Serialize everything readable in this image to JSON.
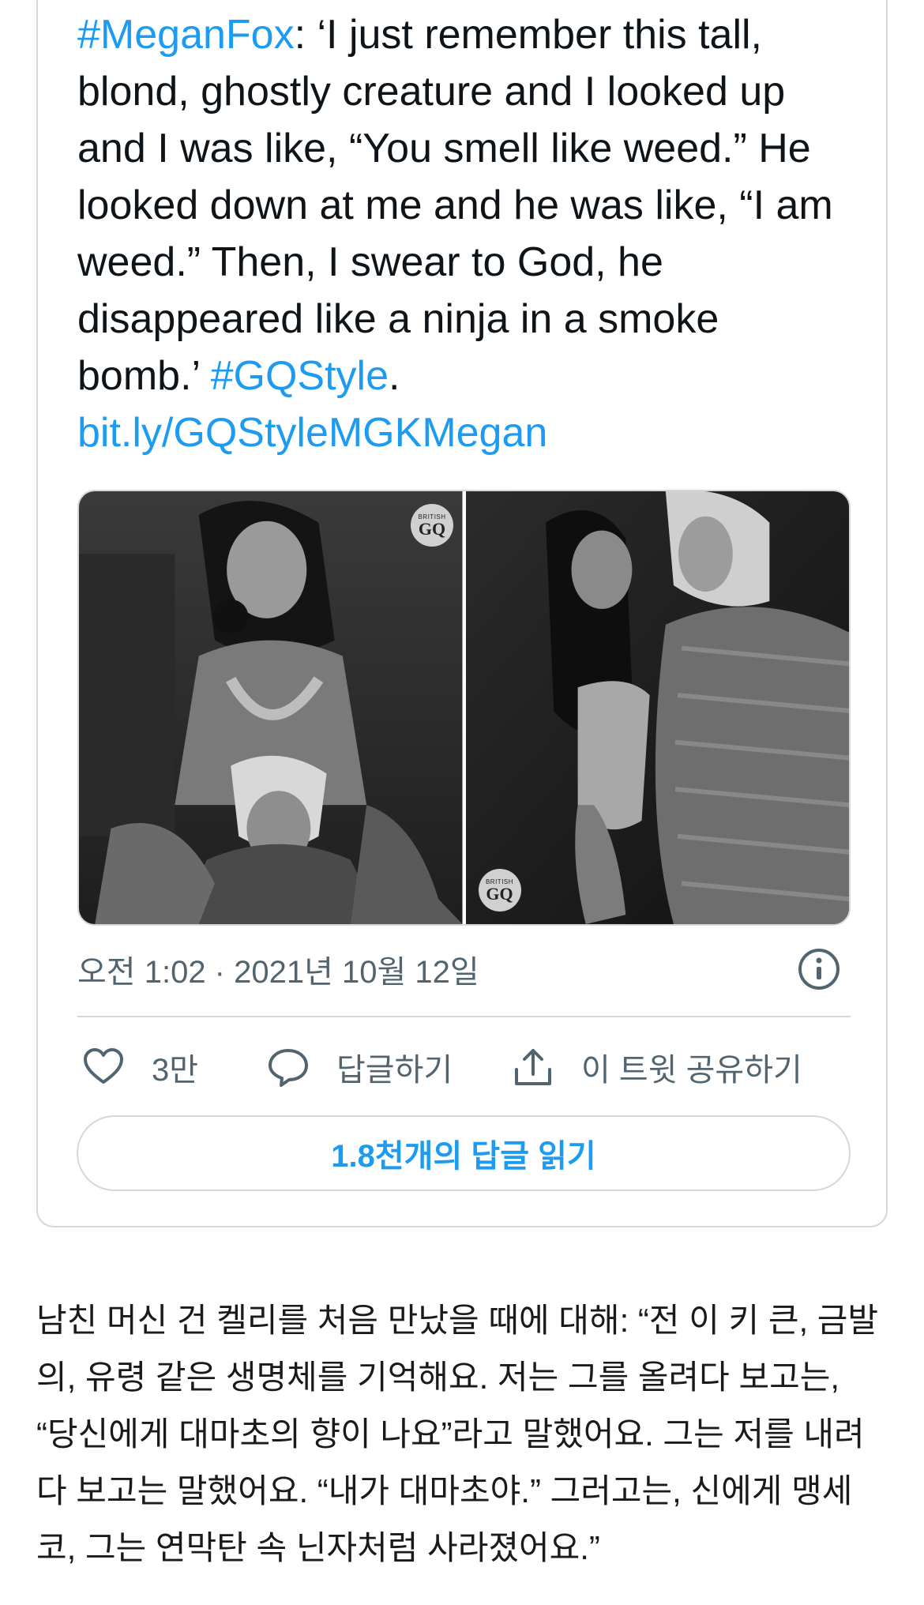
{
  "tweet": {
    "hashtag_megan": "#MeganFox",
    "text_body": ": ‘I just remember this tall, blond, ghostly creature and I looked up and I was like, “You smell like weed.” He looked down at me and he was like, “I am weed.” Then, I swear to God, he disappeared like a ninja in a smoke bomb.’ ",
    "hashtag_gq": "#GQStyle",
    "period": ".",
    "link": "bit.ly/GQStyleMGKMegan",
    "photo_badge": {
      "small": "BRITISH",
      "big": "GQ"
    },
    "timestamp": "오전 1:02 · 2021년 10월 12일",
    "actions": {
      "like_count": "3만",
      "reply_label": "답글하기",
      "share_label": "이 트윗 공유하기"
    },
    "read_replies_button": "1.8천개의 답글 읽기"
  },
  "article": {
    "paragraph": "남친 머신 건 켈리를 처음 만났을 때에 대해: “전 이 키 큰, 금발의, 유령 같은 생명체를 기억해요. 저는 그를 올려다 보고는, “당신에게 대마초의 향이 나요”라고 말했어요. 그는 저를 내려다 보고는 말했어요. “내가 대마초야.” 그러고는, 신에게 맹세코, 그는 연막탄 속 닌자처럼 사라졌어요.”"
  },
  "colors": {
    "accent": "#1d9bf0",
    "border": "#cfd9de",
    "muted": "#536471"
  }
}
